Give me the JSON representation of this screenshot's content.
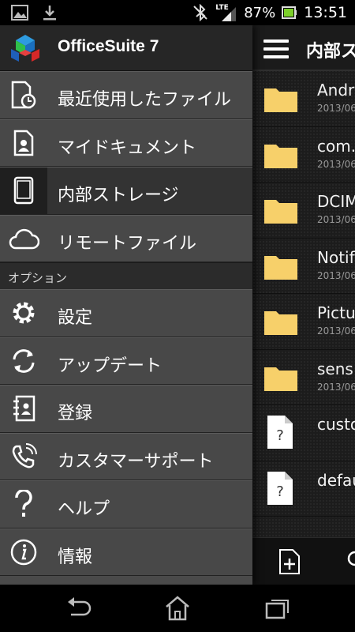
{
  "status_bar": {
    "network": "LTE",
    "battery_percent": "87%",
    "time": "13:51",
    "icons": [
      "image-icon",
      "download-icon",
      "bluetooth-icon",
      "signal-icon",
      "battery-icon"
    ]
  },
  "drawer": {
    "app_title": "OfficeSuite 7",
    "items": [
      {
        "label": "最近使用したファイル",
        "icon": "recent-files-icon"
      },
      {
        "label": "マイドキュメント",
        "icon": "my-documents-icon"
      },
      {
        "label": "内部ストレージ",
        "icon": "tablet-icon",
        "active": true
      },
      {
        "label": "リモートファイル",
        "icon": "cloud-icon"
      }
    ],
    "section_title": "オプション",
    "options": [
      {
        "label": "設定",
        "icon": "gear-icon"
      },
      {
        "label": "アップデート",
        "icon": "refresh-icon"
      },
      {
        "label": "登録",
        "icon": "register-icon"
      },
      {
        "label": "カスタマーサポート",
        "icon": "phone-icon"
      },
      {
        "label": "ヘルプ",
        "icon": "help-icon"
      },
      {
        "label": "情報",
        "icon": "info-icon"
      }
    ]
  },
  "file_pane": {
    "title": "内部ス",
    "files": [
      {
        "name": "Andr",
        "date": "2013/06",
        "type": "folder"
      },
      {
        "name": "com.",
        "date": "2013/06",
        "type": "folder"
      },
      {
        "name": "DCIM",
        "date": "2013/06",
        "type": "folder"
      },
      {
        "name": "Notif",
        "date": "2013/06",
        "type": "folder"
      },
      {
        "name": "Pictu",
        "date": "2013/06",
        "type": "folder"
      },
      {
        "name": "sens",
        "date": "2013/06",
        "type": "folder"
      },
      {
        "name": "custo",
        "date": "",
        "type": "unknown-file"
      },
      {
        "name": "defau",
        "date": "",
        "type": "unknown-file"
      }
    ]
  },
  "colors": {
    "folder": "#f7d06a",
    "drawer_bg": "#484848",
    "active_bg": "#333333",
    "section_bg": "#2b2b2b"
  }
}
